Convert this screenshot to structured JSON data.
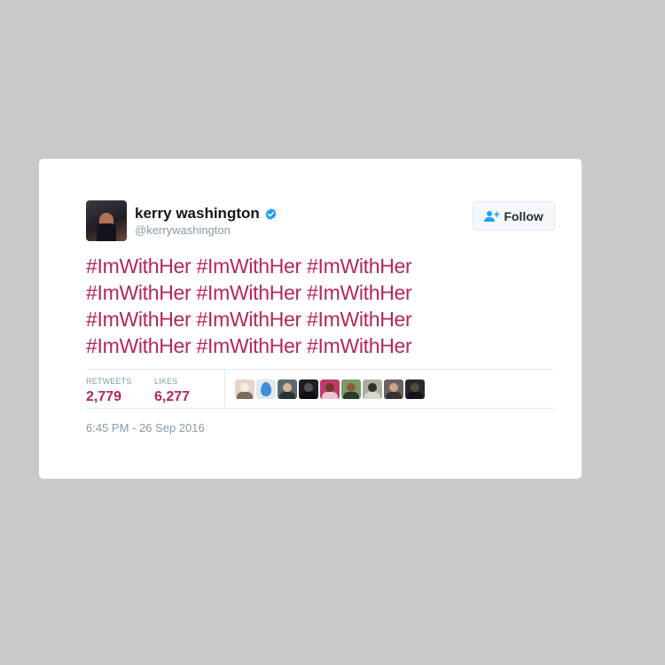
{
  "tweet": {
    "author": {
      "display_name": "kerry washington",
      "handle": "@kerrywashington",
      "verified": true,
      "avatar_icon": "magazine-cover-avatar"
    },
    "follow_button": {
      "label": "Follow",
      "icon": "add-user-icon"
    },
    "text_lines": [
      [
        "#ImWithHer",
        "#ImWithHer",
        "#ImWithHer"
      ],
      [
        "#ImWithHer",
        "#ImWithHer",
        "#ImWithHer"
      ],
      [
        "#ImWithHer",
        "#ImWithHer",
        "#ImWithHer"
      ],
      [
        "#ImWithHer",
        "#ImWithHer",
        "#ImWithHer"
      ]
    ],
    "stats": {
      "retweets_label": "RETWEETS",
      "retweets_value": "2,779",
      "likes_label": "LIKES",
      "likes_value": "6,277"
    },
    "timestamp": "6:45 PM - 26 Sep 2016"
  },
  "colors": {
    "background": "#c9c9c9",
    "card": "#ffffff",
    "hashtag": "#b5255e",
    "verified": "#1da1f2",
    "muted": "#8899a6",
    "follow_icon": "#1da1f2"
  }
}
